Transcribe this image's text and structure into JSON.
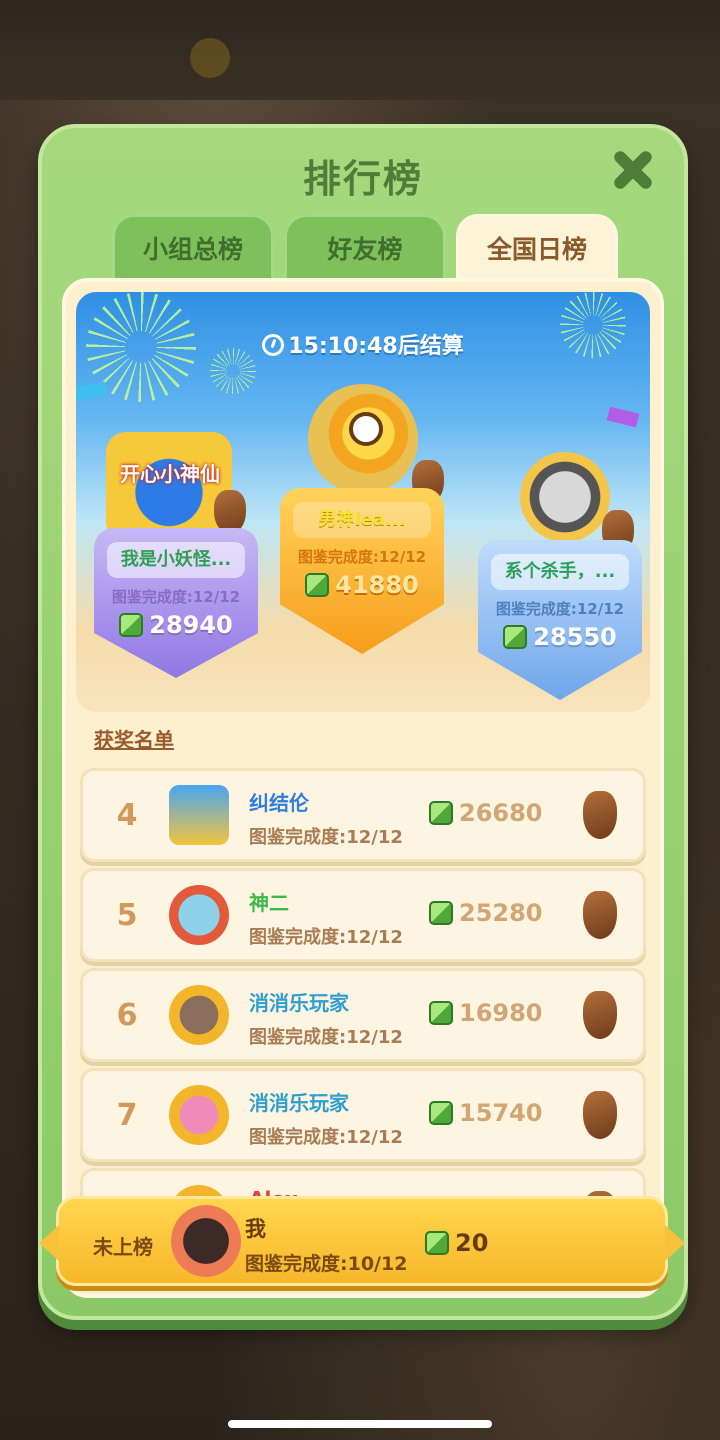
{
  "modal": {
    "title": "排行榜",
    "tabs": [
      {
        "label": "小组总榜",
        "active": false
      },
      {
        "label": "好友榜",
        "active": false
      },
      {
        "label": "全国日榜",
        "active": true
      }
    ]
  },
  "podium": {
    "timer": "15:10:48后结算",
    "first": {
      "name": "男神lea...",
      "progress": "图鉴完成度:12/12",
      "score": "41880"
    },
    "second": {
      "avatar_text": "开心小神仙",
      "name": "我是小妖怪...",
      "progress": "图鉴完成度:12/12",
      "score": "28940"
    },
    "third": {
      "name": "系个杀手，...",
      "progress": "图鉴完成度:12/12",
      "score": "28550"
    }
  },
  "winners_link": "获奖名单",
  "rows": [
    {
      "rank": "4",
      "name": "纠结伦",
      "progress": "图鉴完成度:12/12",
      "score": "26680",
      "name_color": "#2f7fe0"
    },
    {
      "rank": "5",
      "name": "神二",
      "progress": "图鉴完成度:12/12",
      "score": "25280",
      "name_color": "#3fb84a"
    },
    {
      "rank": "6",
      "name": "消消乐玩家",
      "progress": "图鉴完成度:12/12",
      "score": "16980",
      "name_color": "#2f9ed0"
    },
    {
      "rank": "7",
      "name": "消消乐玩家",
      "progress": "图鉴完成度:12/12",
      "score": "15740",
      "name_color": "#2f9ed0"
    },
    {
      "rank": "",
      "name": "Alex...",
      "progress": "",
      "score": "",
      "name_color": "#e0452f"
    }
  ],
  "me": {
    "rank": "未上榜",
    "name": "我",
    "progress": "图鉴完成度:10/12",
    "score": "20"
  },
  "colors": {
    "modal_green": "#8cc966",
    "panel_cream": "#fdf0cf",
    "accent_gold": "#f7b72a"
  }
}
